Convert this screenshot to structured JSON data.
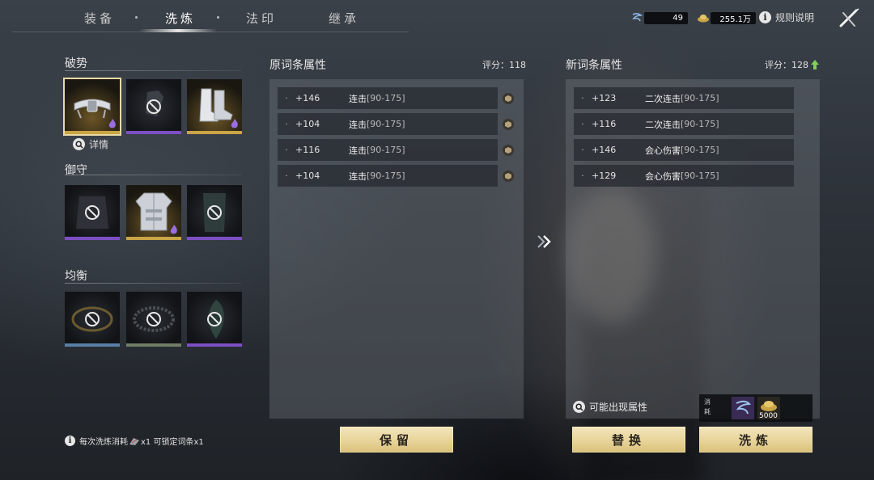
{
  "nav": {
    "tabs": [
      {
        "label": "装备"
      },
      {
        "label": "洗炼"
      },
      {
        "label": "法印"
      },
      {
        "label": "继承"
      }
    ]
  },
  "resources": {
    "gem_count": "49",
    "silver_count": "255.1万",
    "rules_label": "规则说明"
  },
  "equipment": {
    "groups": [
      {
        "title": "破势"
      },
      {
        "title": "御守"
      },
      {
        "title": "均衡"
      }
    ],
    "detail_label": "详情",
    "footnote": {
      "prefix": "每次洗炼消耗",
      "suffix": "x1 可锁定词条x1"
    }
  },
  "original": {
    "title": "原词条属性",
    "score_label": "评分：",
    "score": "118",
    "rows": [
      {
        "bullet": "·",
        "value": "+146",
        "name": "连击",
        "range": "[90-175]"
      },
      {
        "bullet": "·",
        "value": "+104",
        "name": "连击",
        "range": "[90-175]"
      },
      {
        "bullet": "·",
        "value": "+116",
        "name": "连击",
        "range": "[90-175]"
      },
      {
        "bullet": "·",
        "value": "+104",
        "name": "连击",
        "range": "[90-175]"
      }
    ],
    "keep_label": "保留"
  },
  "new": {
    "title": "新词条属性",
    "score_label": "评分：",
    "score": "128",
    "rows": [
      {
        "bullet": "·",
        "value": "+123",
        "name": "二次连击",
        "range": "[90-175]"
      },
      {
        "bullet": "·",
        "value": "+116",
        "name": "二次连击",
        "range": "[90-175]"
      },
      {
        "bullet": "·",
        "value": "+146",
        "name": "会心伤害",
        "range": "[90-175]"
      },
      {
        "bullet": "·",
        "value": "+129",
        "name": "会心伤害",
        "range": "[90-175]"
      }
    ],
    "possible_label": "可能出现属性",
    "cost_label": "消耗",
    "cost_silver": "5000",
    "replace_label": "替换",
    "refine_label": "洗炼"
  },
  "colors": {
    "accent_gold": "#e8d499",
    "rarity_purple": "#7d4fc4",
    "rarity_gold": "#c9a545",
    "rarity_blue": "#5a7fa6",
    "rarity_green": "#6f7d66"
  }
}
